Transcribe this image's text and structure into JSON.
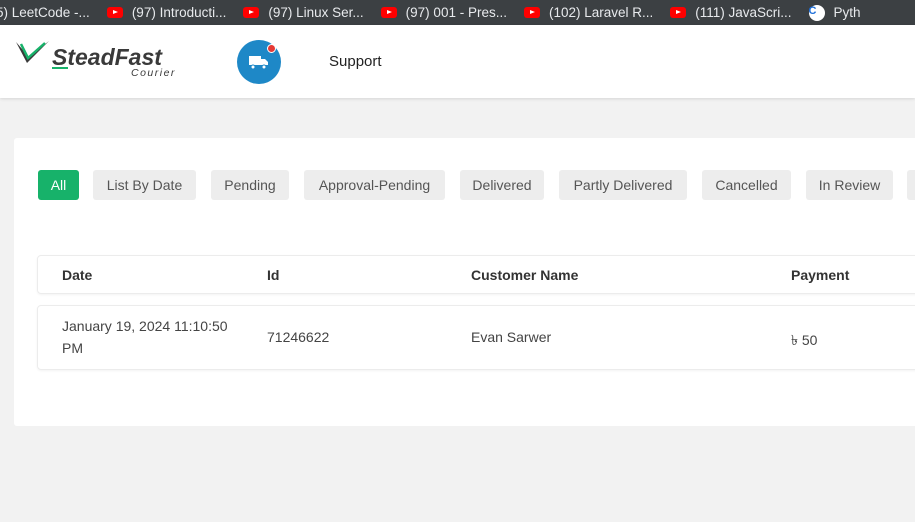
{
  "bookmarks": [
    {
      "label": "5) LeetCode -...",
      "icon": "none"
    },
    {
      "label": "(97) Introducti...",
      "icon": "youtube-icon"
    },
    {
      "label": "(97) Linux Ser...",
      "icon": "youtube-icon"
    },
    {
      "label": "(97) 001 - Pres...",
      "icon": "youtube-icon"
    },
    {
      "label": "(102) Laravel R...",
      "icon": "youtube-icon"
    },
    {
      "label": "(111) JavaScri...",
      "icon": "youtube-icon"
    },
    {
      "label": "Pyth",
      "icon": "c-icon"
    }
  ],
  "brand": {
    "name": "SteadFast",
    "tagline": "Courier",
    "color": "#17b26a"
  },
  "nav": {
    "support_label": "Support",
    "accent": "#1e88c7"
  },
  "filters": [
    "All",
    "List By Date",
    "Pending",
    "Approval-Pending",
    "Delivered",
    "Partly Delivered",
    "Cancelled",
    "In Review"
  ],
  "table": {
    "headers": [
      "Date",
      "Id",
      "Customer Name",
      "Payment"
    ],
    "rows": [
      {
        "date": "January 19, 2024 11:10:50 PM",
        "id": "71246622",
        "customer": "Evan Sarwer",
        "payment": "৳ 50"
      }
    ]
  }
}
